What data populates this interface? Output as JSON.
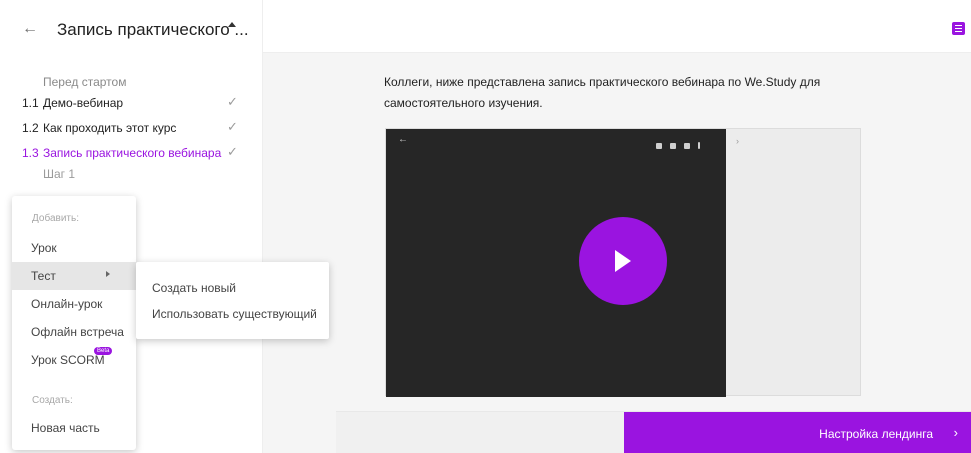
{
  "sidebar": {
    "back_icon": "←",
    "course_title": "Запись практического ...",
    "section_title": "Перед стартом",
    "lessons": [
      {
        "num": "1.1",
        "label": "Демо-вебинар",
        "check": "✓"
      },
      {
        "num": "1.2",
        "label": "Как проходить этот курс",
        "check": "✓"
      },
      {
        "num": "1.3",
        "label": "Запись практического вебинара",
        "check": "✓"
      }
    ],
    "step_title": "Шаг 1"
  },
  "add_menu": {
    "add_heading": "Добавить:",
    "items": [
      "Урок",
      "Тест",
      "Онлайн-урок",
      "Офлайн встреча",
      "Урок SCORM"
    ],
    "beta_badge": "Beta",
    "create_heading": "Создать:",
    "create_items": [
      "Новая часть"
    ]
  },
  "submenu": {
    "items": [
      "Создать новый",
      "Использовать существующий"
    ]
  },
  "main": {
    "description": "Коллеги, ниже представлена запись практического вебинара по We.Study для самостоятельного изучения.",
    "video": {
      "back_icon": "←",
      "side_arrow": "›"
    }
  },
  "footer": {
    "landing_button": "Настройка лендинга",
    "landing_chevron": "›"
  },
  "colors": {
    "accent": "#9a14e0",
    "video_bg": "#262626"
  },
  "icons": [
    "arrow-left-icon",
    "caret-up-icon",
    "check-icon",
    "chevron-right-icon",
    "play-icon",
    "notes-icon"
  ]
}
